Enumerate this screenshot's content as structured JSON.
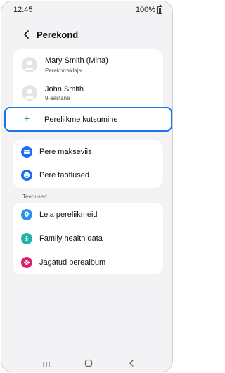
{
  "status_bar": {
    "time": "12:45",
    "battery": "100%"
  },
  "header": {
    "title": "Perekond"
  },
  "members": [
    {
      "name": "Mary Smith (Mina)",
      "role": "Perekorraldaja"
    },
    {
      "name": "John Smith",
      "role": "9-aastane"
    }
  ],
  "invite": {
    "label": "Pereliikme kutsumine"
  },
  "payments": [
    {
      "label": "Pere makseviis",
      "icon": "card-icon"
    },
    {
      "label": "Pere taotlused",
      "icon": "request-face-icon"
    }
  ],
  "services": {
    "section_label": "Teenused",
    "items": [
      {
        "label": "Leia pereliikmeid",
        "icon": "location-pin-icon"
      },
      {
        "label": "Family health data",
        "icon": "health-icon"
      },
      {
        "label": "Jagatud perealbum",
        "icon": "flower-album-icon"
      }
    ]
  },
  "colors": {
    "accent": "#1a73e8",
    "plus": "#2e9c5a",
    "payment_blue": "#1e6ff0",
    "find_blue": "#2a8fe8",
    "health_teal": "#20b3a8",
    "album_pink": "#d8246e"
  }
}
